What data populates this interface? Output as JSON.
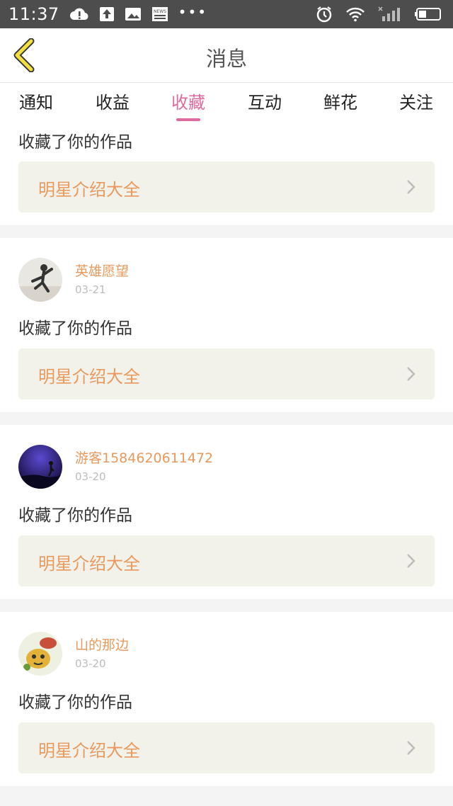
{
  "status_bar": {
    "time": "11:37",
    "left_icons": [
      "cloud-alert-icon",
      "upload-icon",
      "image-icon",
      "news-icon",
      "more-dots-icon"
    ],
    "news_label": "NEWS",
    "right_icons": [
      "alarm-icon",
      "wifi-icon",
      "signal-icon",
      "battery-icon"
    ]
  },
  "header": {
    "back_icon": "chevron-left-icon",
    "title": "消息"
  },
  "tabs": [
    {
      "label": "通知",
      "active": false
    },
    {
      "label": "收益",
      "active": false
    },
    {
      "label": "收藏",
      "active": true
    },
    {
      "label": "互动",
      "active": false
    },
    {
      "label": "鲜花",
      "active": false
    },
    {
      "label": "关注",
      "active": false
    }
  ],
  "colors": {
    "accent": "#e06aa0",
    "username": "#e8995e",
    "work_bg": "#f2f2ea",
    "status_bar": "#4d4d4d"
  },
  "feed": [
    {
      "message": "收藏了你的作品",
      "work": "明星介绍大全"
    },
    {
      "user": "英雄愿望",
      "date": "03-21",
      "message": "收藏了你的作品",
      "work": "明星介绍大全"
    },
    {
      "user": "游客1584620611472",
      "date": "03-20",
      "message": "收藏了你的作品",
      "work": "明星介绍大全"
    },
    {
      "user": "山的那边",
      "date": "03-20",
      "message": "收藏了你的作品",
      "work": "明星介绍大全"
    }
  ]
}
